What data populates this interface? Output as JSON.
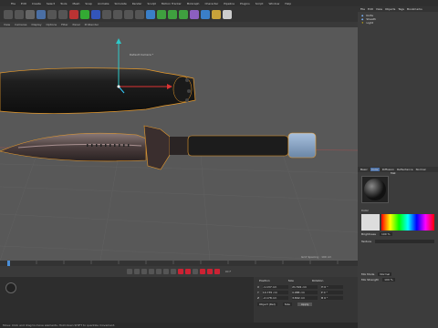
{
  "menu": [
    "File",
    "Edit",
    "Create",
    "Select",
    "Tools",
    "Mesh",
    "Snap",
    "Animate",
    "Simulate",
    "Render",
    "Sculpt",
    "Motion Tracker",
    "MoGraph",
    "Character",
    "Pipeline",
    "Plugins",
    "Script",
    "Window",
    "Help"
  ],
  "viewport": {
    "tabs": [
      "View",
      "Cameras",
      "Display",
      "Options",
      "Filter",
      "Panel",
      "ProRender"
    ],
    "camera_label": "Default Camera *",
    "grid_spacing": "Grid Spacing : 100 cm"
  },
  "object_manager": {
    "tabs": [
      "File",
      "Edit",
      "View",
      "Objects",
      "Tags",
      "Bookmarks"
    ],
    "items": [
      "Knife",
      "Sheath",
      "Light"
    ]
  },
  "attributes": {
    "mode_tabs": [
      "Basic",
      "Color",
      "Diffusion",
      "Reflectance",
      "Normal"
    ],
    "material_name": "Mat",
    "sections": [
      "Color",
      "Brightness",
      "Texture",
      "Mix Mode",
      "Mix Strength"
    ],
    "values": [
      "100 %",
      "Normal",
      "100 %"
    ]
  },
  "coordinates": {
    "headers": [
      "Position",
      "Size",
      "Rotation"
    ],
    "rows": [
      {
        "axis": "X",
        "pos": "-1.137 cm",
        "size": "21.591 cm",
        "rot": "H 0 °"
      },
      {
        "axis": "Y",
        "pos": "10.735 cm",
        "size": "4.088 cm",
        "rot": "P 0 °"
      },
      {
        "axis": "Z",
        "pos": "-2.178 cm",
        "size": "3.892 cm",
        "rot": "B 0 °"
      }
    ],
    "object_rel": "Object (Rel)",
    "size_label": "Size",
    "apply_label": "Apply"
  },
  "status_text": "Move: Click and drag to move elements. Hold down SHIFT to quantize movement.",
  "frame_end": "90 F"
}
